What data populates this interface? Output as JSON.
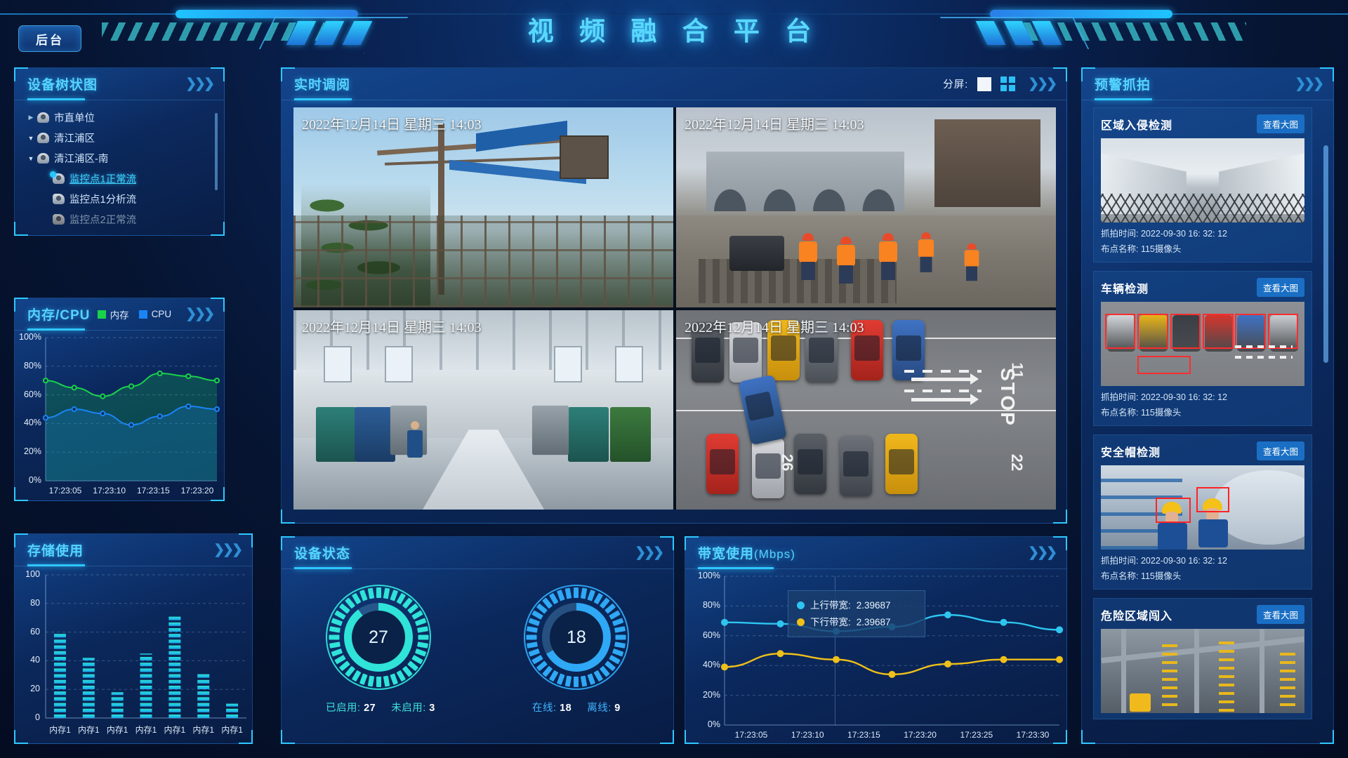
{
  "header": {
    "title": "视 频 融 合 平 台",
    "backstage_label": "后台"
  },
  "device_tree": {
    "panel_title": "设备树状图",
    "items": [
      {
        "label": "市直单位",
        "caret": "▶",
        "level": 0,
        "state": "normal"
      },
      {
        "label": "清江浦区",
        "caret": "▼",
        "level": 0,
        "state": "normal"
      },
      {
        "label": "清江浦区-南",
        "caret": "▼",
        "level": 0,
        "state": "normal"
      },
      {
        "label": "监控点1正常流",
        "caret": "",
        "level": 1,
        "state": "active"
      },
      {
        "label": "监控点1分析流",
        "caret": "",
        "level": 1,
        "state": "normal"
      },
      {
        "label": "监控点2正常流",
        "caret": "",
        "level": 1,
        "state": "dim"
      }
    ]
  },
  "mem_cpu": {
    "panel_title": "内存/CPU",
    "legend": [
      {
        "label": "内存",
        "color": "#19d24a"
      },
      {
        "label": "CPU",
        "color": "#1a84f5"
      }
    ]
  },
  "storage": {
    "panel_title": "存储使用"
  },
  "video": {
    "panel_title": "实时调阅",
    "split_label": "分屏:",
    "split_options": [
      {
        "name": "single-pane",
        "selected": false
      },
      {
        "name": "quad-pane",
        "selected": true
      }
    ],
    "cells": [
      {
        "timestamp": "2022年12月14日 星期三 14:03",
        "scene": "construction-crane"
      },
      {
        "timestamp": "2022年12月14日 星期三 14:03",
        "scene": "road-workers"
      },
      {
        "timestamp": "2022年12月14日 星期三 14:03",
        "scene": "factory-floor"
      },
      {
        "timestamp": "2022年12月14日 星期三 14:03",
        "scene": "parking-lot"
      }
    ],
    "parking_markings": {
      "lane_number_left": "26",
      "lane_number_mid": "11",
      "lane_number_right": "22",
      "stop_text": "STOP"
    }
  },
  "device_status": {
    "panel_title": "设备状态",
    "gauges": [
      {
        "value": "27",
        "color": "#2fe3d8",
        "percent": 90,
        "captions": [
          {
            "key": "已启用:",
            "value": "27"
          },
          {
            "key": "未启用:",
            "value": "3"
          }
        ]
      },
      {
        "value": "18",
        "color": "#2fa8f5",
        "percent": 67,
        "captions": [
          {
            "key": "在线:",
            "value": "18"
          },
          {
            "key": "离线:",
            "value": "9"
          }
        ]
      }
    ]
  },
  "bandwidth": {
    "panel_title": "带宽使用",
    "panel_title_unit": "(Mbps)",
    "tooltip": [
      {
        "label": "上行带宽:",
        "value": "2.39687",
        "color": "#2ec6f0"
      },
      {
        "label": "下行带宽:",
        "value": "2.39687",
        "color": "#f0c01a"
      }
    ]
  },
  "alerts": {
    "panel_title": "预警抓拍",
    "view_button_label": "查看大图",
    "time_key": "抓拍时间:",
    "site_key": "布点名称:",
    "cards": [
      {
        "title": "区域入侵检测",
        "time": "2022-09-30  16: 32: 12",
        "site": "115摄像头",
        "scene": "warehouse-gate"
      },
      {
        "title": "车辆检测",
        "time": "2022-09-30  16: 32: 12",
        "site": "115摄像头",
        "scene": "vehicle-row"
      },
      {
        "title": "安全帽检测",
        "time": "2022-09-30  16: 32: 12",
        "site": "115摄像头",
        "scene": "helmet-workers"
      },
      {
        "title": "危险区域闯入",
        "time": "",
        "site": "",
        "scene": "industrial-plant"
      }
    ]
  },
  "chart_data": [
    {
      "type": "line",
      "id": "mem-cpu",
      "title": "内存/CPU",
      "x": [
        "17:23:05",
        "17:23:10",
        "17:23:15",
        "17:23:20"
      ],
      "xlabel": "",
      "ylabel": "",
      "ylim": [
        0,
        100
      ],
      "yticks": [
        "0%",
        "20%",
        "40%",
        "60%",
        "80%",
        "100%"
      ],
      "grid": true,
      "legend_position": "top-right",
      "series": [
        {
          "name": "内存",
          "color": "#19d24a",
          "values": [
            70,
            65,
            59,
            66,
            75,
            73,
            70
          ]
        },
        {
          "name": "CPU",
          "color": "#1a84f5",
          "values": [
            44,
            50,
            47,
            39,
            45,
            52,
            50
          ]
        }
      ]
    },
    {
      "type": "bar",
      "id": "storage-usage",
      "title": "存储使用",
      "categories": [
        "内存1",
        "内存1",
        "内存1",
        "内存1",
        "内存1",
        "内存1",
        "内存1"
      ],
      "values": [
        60,
        42,
        18,
        45,
        72,
        31,
        10
      ],
      "xlabel": "",
      "ylabel": "",
      "ylim": [
        0,
        100
      ],
      "yticks": [
        "0",
        "20",
        "40",
        "60",
        "80",
        "100"
      ],
      "grid": true,
      "bar_color": "#2ce0d2",
      "bar_color_bottom": "#19a8f0"
    },
    {
      "type": "line",
      "id": "bandwidth",
      "title": "带宽使用(Mbps)",
      "x": [
        "17:23:05",
        "17:23:10",
        "17:23:15",
        "17:23:20",
        "17:23:25",
        "17:23:30"
      ],
      "xlabel": "",
      "ylabel": "",
      "ylim": [
        0,
        100
      ],
      "yticks": [
        "0%",
        "20%",
        "40%",
        "60%",
        "80%",
        "100%"
      ],
      "grid": true,
      "series": [
        {
          "name": "上行带宽",
          "color": "#2ec6f0",
          "values": [
            69,
            68,
            63,
            66,
            74,
            69,
            64
          ]
        },
        {
          "name": "下行带宽",
          "color": "#f0c01a",
          "values": [
            39,
            48,
            44,
            34,
            41,
            44,
            44
          ]
        }
      ]
    }
  ]
}
